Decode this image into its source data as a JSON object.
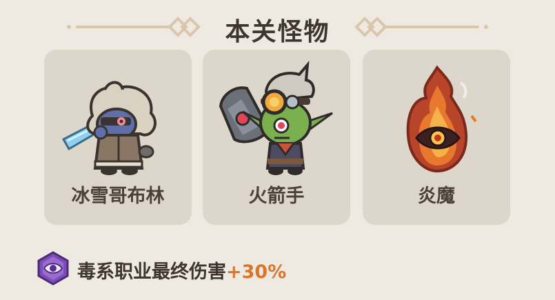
{
  "section_title": "本关怪物",
  "monsters": [
    {
      "name": "冰雪哥布林",
      "icon": "ice-goblin-icon"
    },
    {
      "name": "火箭手",
      "icon": "goblin-rocketeer-icon"
    },
    {
      "name": "炎魔",
      "icon": "flame-demon-icon"
    }
  ],
  "bonus": {
    "icon": "poison-eye-badge-icon",
    "label": "毒系职业最终伤害",
    "value": "+30%"
  },
  "colors": {
    "background": "#efeae1",
    "card": "#ddd6ca",
    "title_text": "#3e3530",
    "ornament": "#d9c7ab",
    "bonus_value": "#d9762a",
    "badge": "#7c4db5"
  }
}
